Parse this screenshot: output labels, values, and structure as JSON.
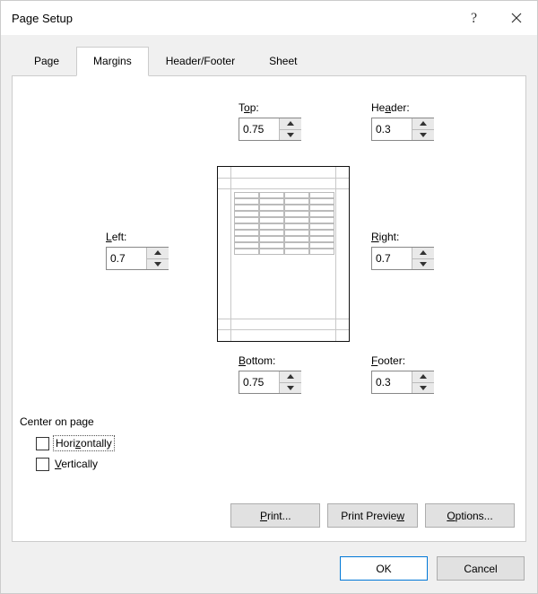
{
  "title": "Page Setup",
  "tabs": [
    "Page",
    "Margins",
    "Header/Footer",
    "Sheet"
  ],
  "active_tab": "Margins",
  "margins": {
    "top": {
      "label_pre": "T",
      "label_u": "o",
      "label_post": "p:",
      "value": "0.75"
    },
    "header": {
      "label_pre": "He",
      "label_u": "a",
      "label_post": "der:",
      "value": "0.3"
    },
    "left": {
      "label_pre": "",
      "label_u": "L",
      "label_post": "eft:",
      "value": "0.7"
    },
    "right": {
      "label_pre": "",
      "label_u": "R",
      "label_post": "ight:",
      "value": "0.7"
    },
    "bottom": {
      "label_pre": "",
      "label_u": "B",
      "label_post": "ottom:",
      "value": "0.75"
    },
    "footer": {
      "label_pre": "",
      "label_u": "F",
      "label_post": "ooter:",
      "value": "0.3"
    }
  },
  "center_group": "Center on page",
  "center": {
    "horizontally": {
      "label_pre": "Hori",
      "label_u": "z",
      "label_post": "ontally",
      "checked": false
    },
    "vertically": {
      "label_pre": "",
      "label_u": "V",
      "label_post": "ertically",
      "checked": false
    }
  },
  "buttons": {
    "print": {
      "pre": "",
      "u": "P",
      "post": "rint..."
    },
    "preview": {
      "pre": "Print Previe",
      "u": "w",
      "post": ""
    },
    "options": {
      "pre": "",
      "u": "O",
      "post": "ptions..."
    },
    "ok": "OK",
    "cancel": "Cancel"
  }
}
